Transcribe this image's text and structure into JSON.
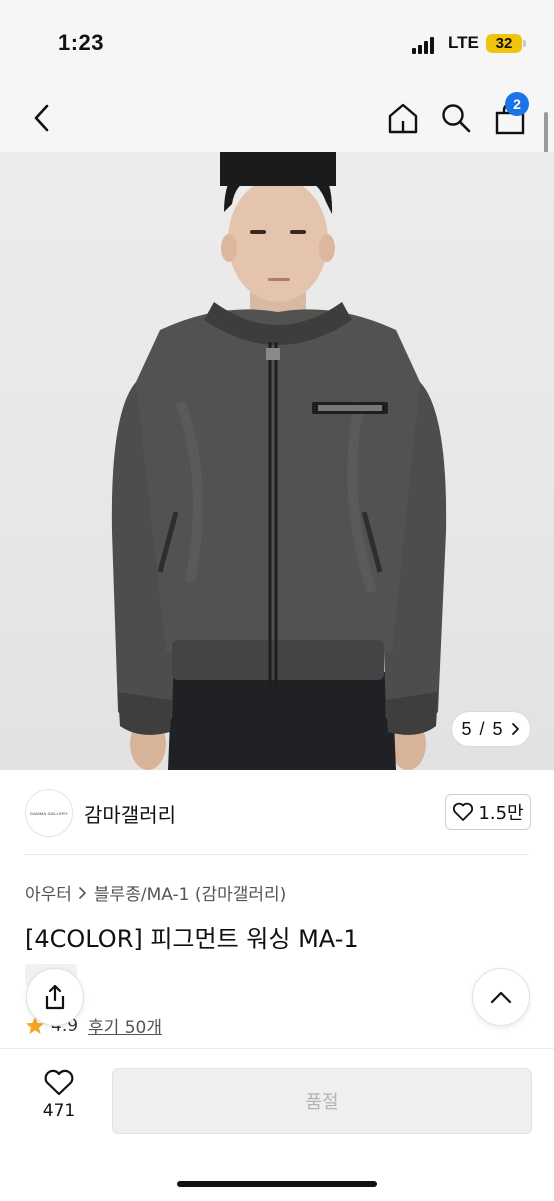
{
  "status_bar": {
    "time": "1:23",
    "network": "LTE",
    "battery": "32"
  },
  "nav": {
    "cart_count": "2"
  },
  "gallery": {
    "current": "5",
    "separator": "/",
    "total": "5"
  },
  "brand": {
    "name": "감마갤러리",
    "logo_text": "GAMMA GALLERY",
    "likes": "1.5만"
  },
  "product": {
    "breadcrumb": [
      "아우터",
      "블루종/MA-1 (감마갤러리)"
    ],
    "title": "[4COLOR] 피그먼트 워싱 MA-1",
    "rating": "4.9",
    "reviews": "후기 50개"
  },
  "bottom": {
    "wish_count": "471",
    "buy_label": "품절"
  },
  "colors": {
    "accent": "#1a73e8",
    "star": "#f5a623",
    "jacket": "#4a4b4a"
  }
}
